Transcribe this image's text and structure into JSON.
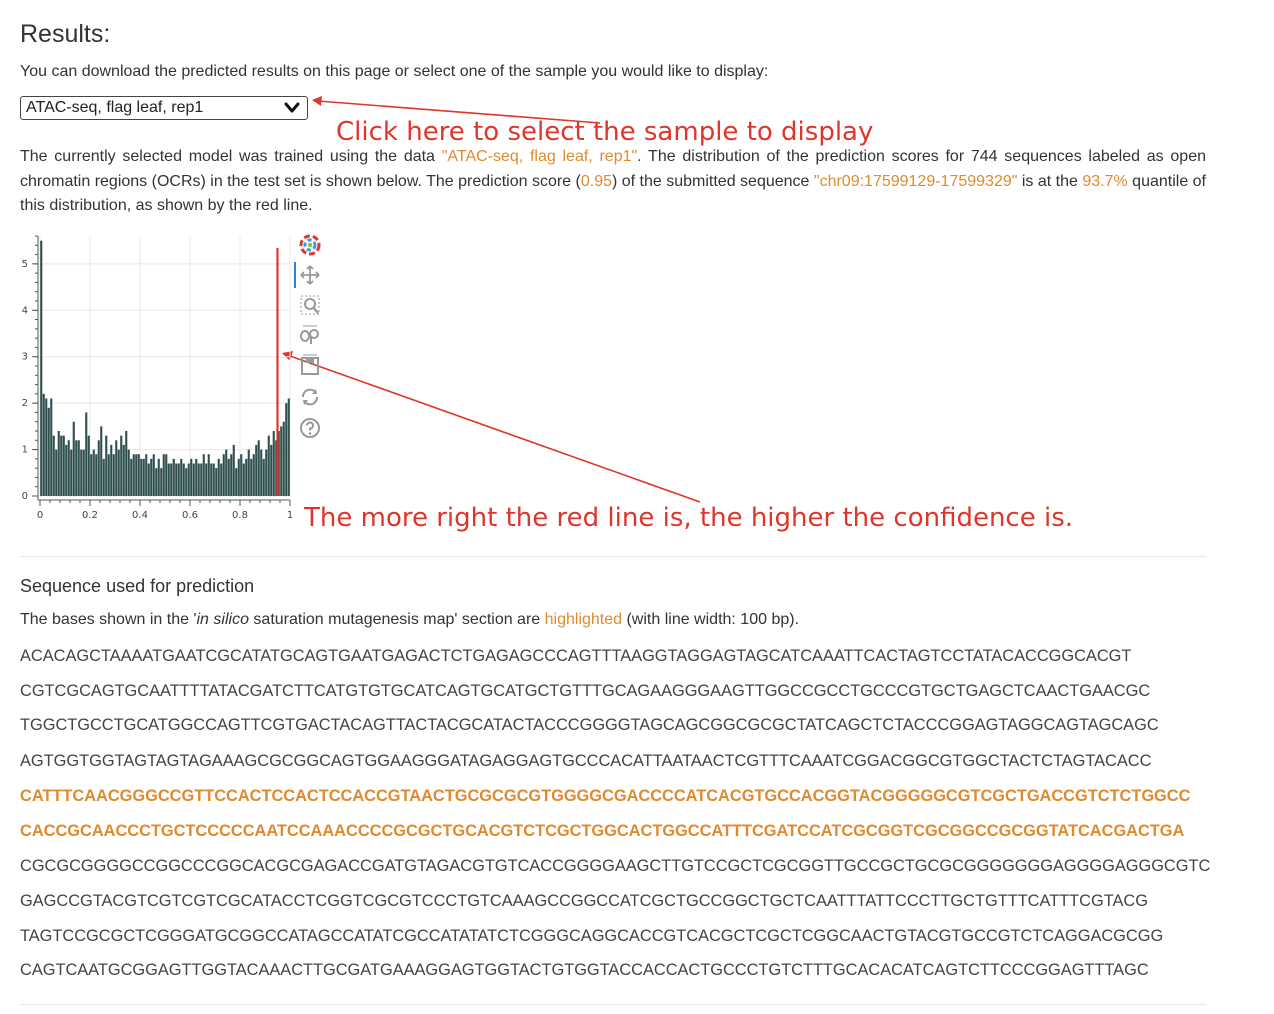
{
  "heading": "Results:",
  "intro": "You can download the predicted results on this page or select one of the sample you would like to display:",
  "select": {
    "value": "ATAC-seq, flag leaf, rep1"
  },
  "annotations": {
    "select_hint": "Click here to select the sample to display",
    "line_hint": "The more right the red line is, the higher the confidence is."
  },
  "description": {
    "part1": "The currently selected model was trained using the data ",
    "sample": "\"ATAC-seq, flag leaf, rep1\"",
    "part2": ". The distribution of the prediction scores for 744 sequences labeled as open chromatin regions (OCRs) in the test set is shown below. The prediction score (",
    "score": "0.95",
    "part3": ") of the submitted sequence ",
    "region": "\"chr09:17599129-17599329\"",
    "part4": " is at the ",
    "quantile": "93.7%",
    "part5": " quantile of this distribution, as shown by the red line."
  },
  "toolbar": [
    {
      "name": "bokeh-logo-icon"
    },
    {
      "name": "pan-icon"
    },
    {
      "name": "box-zoom-icon"
    },
    {
      "name": "wheel-zoom-icon"
    },
    {
      "name": "save-icon"
    },
    {
      "name": "reset-icon"
    },
    {
      "name": "help-icon"
    }
  ],
  "chart_data": {
    "type": "bar",
    "xlim": [
      0,
      1
    ],
    "ylim": [
      0,
      5.6
    ],
    "x_ticks": [
      "0",
      "0.2",
      "0.4",
      "0.6",
      "0.8",
      "1"
    ],
    "y_ticks": [
      "0",
      "1",
      "2",
      "3",
      "4",
      "5"
    ],
    "grid": true,
    "bin_values": [
      5.5,
      2.2,
      2.1,
      1.9,
      2.1,
      1.3,
      1.0,
      1.4,
      1.3,
      1.3,
      1.1,
      1.2,
      1.0,
      1.6,
      1.2,
      1.2,
      1.0,
      1.0,
      1.8,
      1.3,
      0.9,
      1.0,
      0.9,
      1.2,
      1.5,
      0.8,
      1.3,
      0.9,
      1.1,
      0.9,
      1.2,
      1.0,
      1.3,
      1.1,
      1.4,
      1.0,
      0.8,
      0.9,
      0.9,
      0.9,
      0.8,
      0.8,
      0.9,
      0.7,
      0.8,
      0.9,
      0.6,
      0.8,
      0.6,
      0.9,
      0.9,
      0.7,
      0.7,
      0.8,
      0.7,
      0.7,
      0.8,
      0.7,
      0.6,
      0.7,
      0.8,
      0.7,
      0.8,
      0.7,
      0.7,
      0.9,
      0.7,
      0.9,
      0.7,
      0.7,
      0.6,
      0.8,
      0.7,
      0.9,
      1.0,
      0.8,
      0.9,
      1.1,
      0.6,
      0.8,
      0.9,
      0.7,
      0.8,
      1.0,
      0.8,
      0.9,
      1.1,
      1.2,
      1.0,
      0.8,
      1.0,
      1.3,
      1.1,
      1.4,
      1.2,
      1.4,
      1.5,
      1.6,
      2.0,
      2.1
    ],
    "bar_color": "#2f4f4f",
    "marker_value": 0.95,
    "marker_color": "#e0352b"
  },
  "sequence": {
    "heading": "Sequence used for prediction",
    "note": {
      "part1": "The bases shown in the '",
      "italic": "in silico",
      "part2": " saturation mutagenesis map' section are ",
      "highlight": "highlighted",
      "part3": " (with line width: 100 bp)."
    },
    "lines": [
      {
        "text": "ACACAGCTAAAATGAATCGCATATGCAGTGAATGAGACTCTGAGAGCCCAGTTTAAGGTAGGAGTAGCATCAAATTCACTAGTCCTATACACCGGCACGT",
        "highlighted": false
      },
      {
        "text": "CGTCGCAGTGCAATTTTATACGATCTTCATGTGTGCATCAGTGCATGCTGTTTGCAGAAGGGAAGTTGGCCGCCTGCCCGTGCTGAGCTCAACTGAACGC",
        "highlighted": false
      },
      {
        "text": "TGGCTGCCTGCATGGCCAGTTCGTGACTACAGTTACTACGCATACTACCCGGGGTAGCAGCGGCGCGCTATCAGCTCTACCCGGAGTAGGCAGTAGCAGC",
        "highlighted": false
      },
      {
        "text": "AGTGGTGGTAGTAGTAGAAAGCGCGGCAGTGGAAGGGATAGAGGAGTGCCCACATTAATAACTCGTTTCAAATCGGACGGCGTGGCTACTCTAGTACACC",
        "highlighted": false
      },
      {
        "text": "CATTTCAACGGGCCGTTCCACTCCACTCCACCGTAACTGCGCGCGTGGGGCGACCCCATCACGTGCCACGGTACGGGGGCGTCGCTGACCGTCTCTGGCC",
        "highlighted": true
      },
      {
        "text": "CACCGCAACCCTGCTCCCCCAATCCAAACCCCGCGCTGCACGTCTCGCTGGCACTGGCCATTTCGATCCATCGCGGTCGCGGCCGCGGTATCACGACTGA",
        "highlighted": true
      },
      {
        "text": "CGCGCGGGGCCGGCCCGGCACGCGAGACCGATGTAGACGTGTCACCGGGGAAGCTTGTCCGCTCGCGGTTGCCGCTGCGCGGGGGGGAGGGGAGGGCGTC",
        "highlighted": false
      },
      {
        "text": "GAGCCGTACGTCGTCGTCGCATACCTCGGTCGCGTCCCTGTCAAAGCCGGCCATCGCTGCCGGCTGCTCAATTTATTCCCTTGCTGTTTCATTTCGTACG",
        "highlighted": false
      },
      {
        "text": "TAGTCCGCGCTCGGGATGCGGCCATAGCCATATCGCCATATATCTCGGGCAGGCACCGTCACGCTCGCTCGGCAACTGTACGTGCCGTCTCAGGACGCGG",
        "highlighted": false
      },
      {
        "text": "CAGTCAATGCGGAGTTGGTACAAACTTGCGATGAAAGGAGTGGTACTGTGGTACCACCACTGCCCTGTCTTTGCACACATCAGTCTTCCCGGAGTTTAGC",
        "highlighted": false
      }
    ]
  }
}
